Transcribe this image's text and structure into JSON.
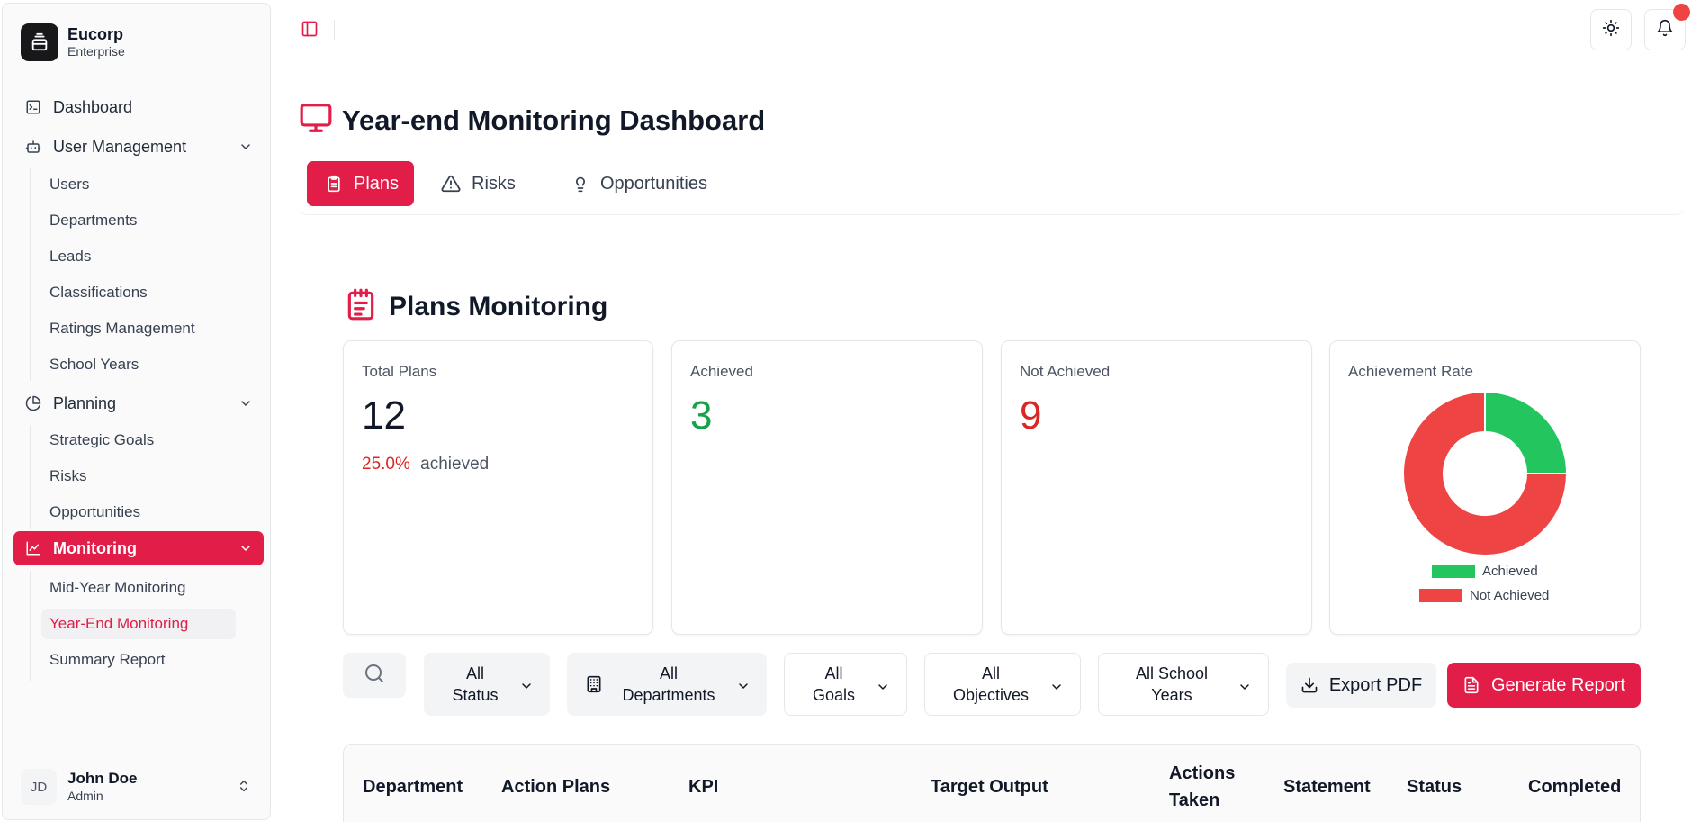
{
  "brand": {
    "name": "Eucorp",
    "subtitle": "Enterprise"
  },
  "sidebar": {
    "dashboard": "Dashboard",
    "user_management": {
      "label": "User Management",
      "items": [
        "Users",
        "Departments",
        "Leads",
        "Classifications",
        "Ratings Management",
        "School Years"
      ]
    },
    "planning": {
      "label": "Planning",
      "items": [
        "Strategic Goals",
        "Risks",
        "Opportunities"
      ]
    },
    "monitoring": {
      "label": "Monitoring",
      "items": [
        "Mid-Year Monitoring",
        "Year-End Monitoring",
        "Summary Report"
      ],
      "current": "Year-End Monitoring"
    }
  },
  "user": {
    "initials": "JD",
    "name": "John Doe",
    "role": "Admin"
  },
  "page": {
    "title": "Year-end Monitoring Dashboard",
    "tabs": [
      "Plans",
      "Risks",
      "Opportunities"
    ],
    "active_tab": "Plans"
  },
  "section": {
    "title": "Plans Monitoring",
    "cards": {
      "total": {
        "label": "Total Plans",
        "value": "12",
        "percent": "25.0%",
        "percent_suffix": "achieved"
      },
      "achieved": {
        "label": "Achieved",
        "value": "3"
      },
      "not_achieved": {
        "label": "Not Achieved",
        "value": "9"
      },
      "rate": {
        "label": "Achievement Rate"
      }
    }
  },
  "chart_data": {
    "type": "pie",
    "variant": "doughnut",
    "categories": [
      "Achieved",
      "Not Achieved"
    ],
    "values": [
      3,
      9
    ],
    "colors": [
      "#22c55e",
      "#ef4444"
    ],
    "legend": "bottom"
  },
  "filters": {
    "status": "All\nStatus",
    "departments": "All\nDepartments",
    "goals": "All\nGoals",
    "objectives": "All\nObjectives",
    "school_years": "All School\nYears"
  },
  "buttons": {
    "export": "Export PDF",
    "generate": "Generate Report"
  },
  "table": {
    "headers": [
      "Department",
      "Action Plans",
      "KPI",
      "Target Output",
      "Actions\nTaken",
      "Statement",
      "Status",
      "Completed"
    ]
  },
  "colors": {
    "accent": "#e11d48",
    "success": "#16a34a",
    "danger": "#dc2626"
  }
}
